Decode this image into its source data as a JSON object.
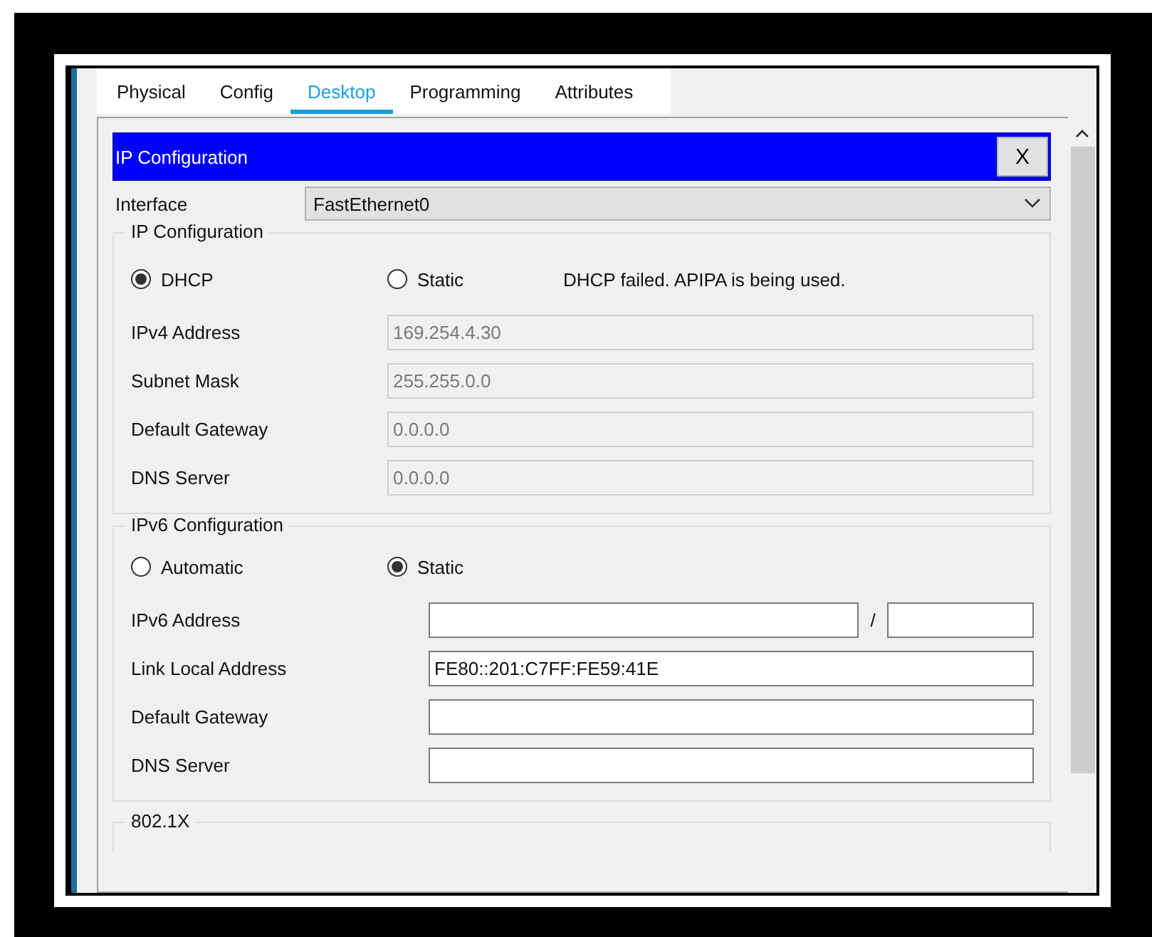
{
  "tabs": [
    {
      "label": "Physical",
      "selected": false
    },
    {
      "label": "Config",
      "selected": false
    },
    {
      "label": "Desktop",
      "selected": true
    },
    {
      "label": "Programming",
      "selected": false
    },
    {
      "label": "Attributes",
      "selected": false
    }
  ],
  "dialog": {
    "title": "IP Configuration",
    "close": "X"
  },
  "interface": {
    "label": "Interface",
    "value": "FastEthernet0"
  },
  "ip_configuration": {
    "title": "IP Configuration",
    "modes": [
      {
        "label": "DHCP",
        "selected": true
      },
      {
        "label": "Static",
        "selected": false
      }
    ],
    "status": "DHCP failed. APIPA is being used.",
    "fields": [
      {
        "label": "IPv4 Address",
        "value": "169.254.4.30",
        "disabled": true
      },
      {
        "label": "Subnet Mask",
        "value": "255.255.0.0",
        "disabled": true
      },
      {
        "label": "Default Gateway",
        "value": "0.0.0.0",
        "disabled": true
      },
      {
        "label": "DNS Server",
        "value": "0.0.0.0",
        "disabled": true
      }
    ]
  },
  "ipv6_configuration": {
    "title": "IPv6 Configuration",
    "modes": [
      {
        "label": "Automatic",
        "selected": false
      },
      {
        "label": "Static",
        "selected": true
      }
    ],
    "fields": [
      {
        "label": "IPv6 Address",
        "kind": "prefixed",
        "separator": "/",
        "disabled": false
      },
      {
        "label": "Link Local Address",
        "kind": "plain",
        "value": "FE80::201:C7FF:FE59:41E",
        "disabled": false
      },
      {
        "label": "Default Gateway",
        "kind": "plain",
        "disabled": false
      },
      {
        "label": "DNS Server",
        "kind": "plain",
        "disabled": false
      }
    ]
  },
  "section_8021x": {
    "title": "802.1X"
  }
}
